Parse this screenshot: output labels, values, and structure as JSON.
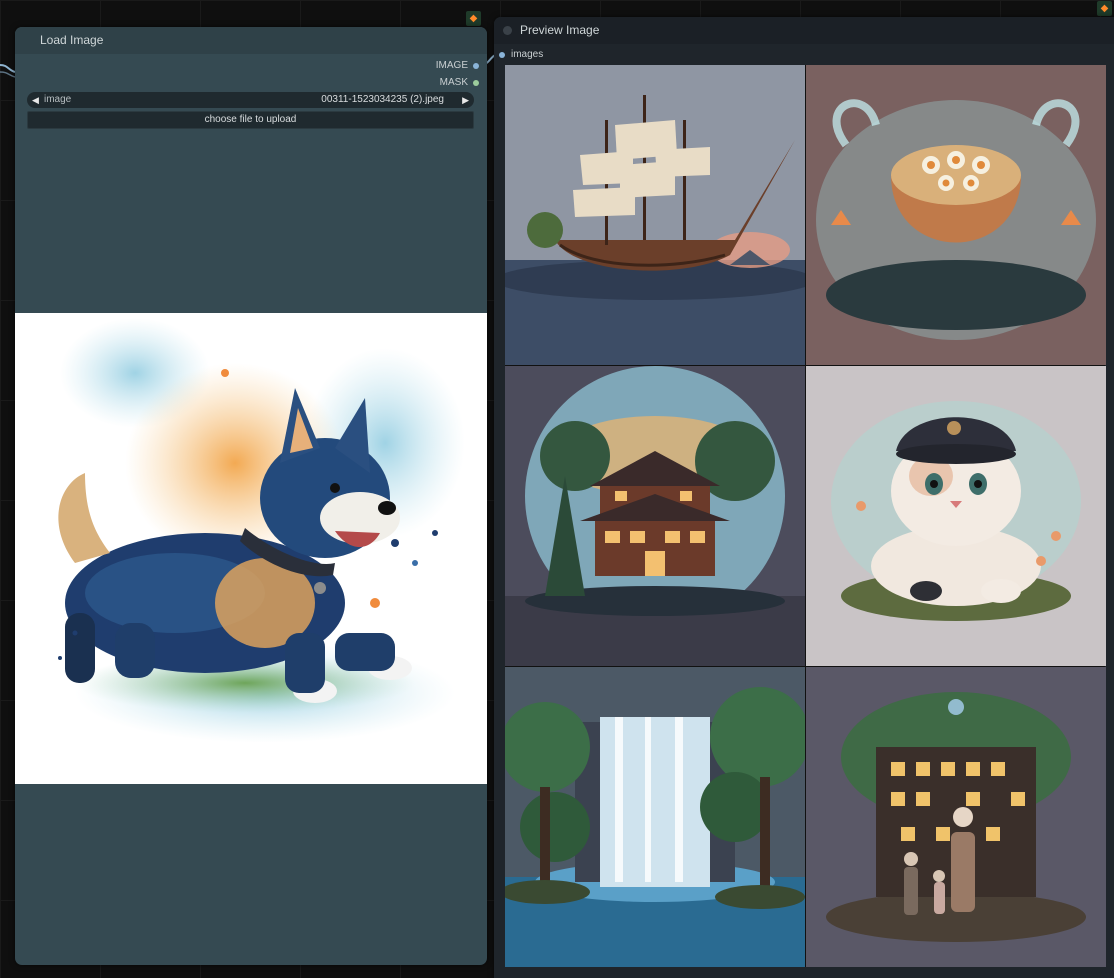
{
  "load_node": {
    "title": "Load Image",
    "outputs": [
      {
        "label": "IMAGE",
        "color": "#64b5f6"
      },
      {
        "label": "MASK",
        "color": "#81c784"
      }
    ],
    "widget_image": {
      "label": "image",
      "value": "00311-1523034235 (2).jpeg",
      "arrow_left": "◀",
      "arrow_right": "▶"
    },
    "upload_button": "choose file to upload",
    "preview_subject": "watercolor-dog"
  },
  "preview_node": {
    "title": "Preview Image",
    "input": {
      "label": "images",
      "color": "#64b5f6"
    },
    "images": [
      {
        "name": "sailing-ship"
      },
      {
        "name": "ramen-bowl"
      },
      {
        "name": "pagoda-house"
      },
      {
        "name": "cat-with-cap"
      },
      {
        "name": "waterfall"
      },
      {
        "name": "treehouse-with-family"
      }
    ]
  },
  "badges": [
    {
      "name": "fox-icon"
    },
    {
      "name": "fox-icon"
    }
  ],
  "colors": {
    "canvas_bg": "#0f0f0f",
    "load_node_body": "#354a52",
    "load_node_title": "#2f4148",
    "preview_node_body": "#1f252b",
    "widget_bg": "#1f2a2f"
  }
}
